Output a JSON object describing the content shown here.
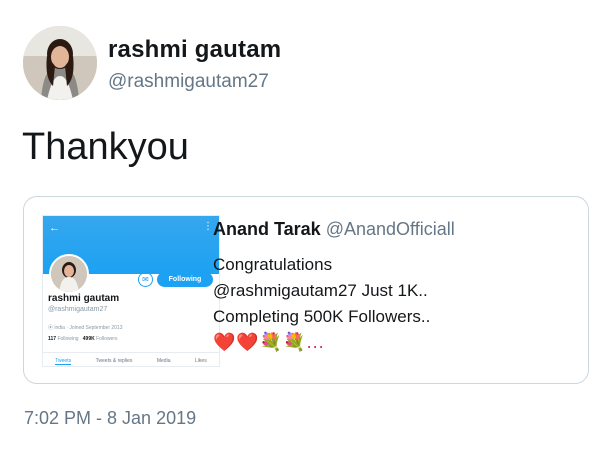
{
  "tweet": {
    "author_name": "rashmi gautam",
    "author_handle": "@rashmigautam27",
    "text": "Thankyou",
    "timestamp": "7:02 PM - 8 Jan 2019"
  },
  "quoted": {
    "author_name": "Anand Tarak",
    "author_handle": "@AnandOfficiall",
    "lines": [
      "Congratulations",
      "@rashmigautam27 Just 1K..",
      "Completing 500K Followers.."
    ],
    "emoji": "❤️❤️💐💐...",
    "media": {
      "profile_name": "rashmi gautam",
      "profile_handle": "@rashmigautam27",
      "follow_label": "Following",
      "meta": "⦿ india · Joined September 2013",
      "following_count": "117",
      "following_label": "Following",
      "followers_count": "499K",
      "followers_label": "Followers",
      "tabs": [
        "Tweets",
        "Tweets & replies",
        "Media",
        "Likes"
      ]
    }
  }
}
